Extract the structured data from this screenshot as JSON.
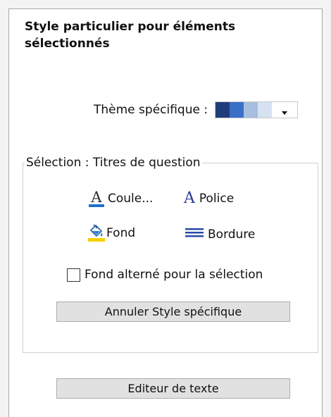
{
  "panel": {
    "title": "Style particulier pour éléments sélectionnés"
  },
  "theme": {
    "label": "Thème spécifique :",
    "swatches": [
      "#1f3d7a",
      "#3a6fc8",
      "#a6bedf",
      "#d6e2f1",
      "#ffffff"
    ]
  },
  "selection": {
    "legend": "Sélection : Titres de question",
    "font_color_label": "Coule...",
    "font_label": "Police",
    "fill_label": "Fond",
    "border_label": "Bordure",
    "alternate_fill_label": "Fond alterné pour la sélection",
    "alternate_fill_checked": false,
    "cancel_button": "Annuler Style spécifique",
    "font_color_icon": "font-color-icon",
    "font_icon": "font-icon",
    "fill_icon": "fill-bucket-icon",
    "border_icon": "border-lines-icon",
    "font_color_accent": "#1d6fce",
    "fill_accent": "#f5d000"
  },
  "editor_button": "Editeur de texte"
}
